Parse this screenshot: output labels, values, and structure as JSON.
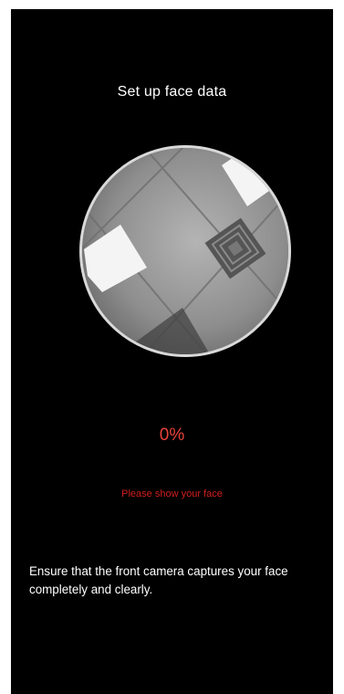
{
  "screen": {
    "title": "Set up face data",
    "progress_text": "0%",
    "progress_value": 0,
    "status_message": "Please show your face",
    "instructions": "Ensure that the front camera captures your face completely and clearly."
  },
  "colors": {
    "background": "#000000",
    "accent": "#e8433a",
    "status": "#d31f1f",
    "text": "#ffffff",
    "frame_border": "#d9d9d9"
  },
  "camera": {
    "icon": "camera-preview"
  }
}
